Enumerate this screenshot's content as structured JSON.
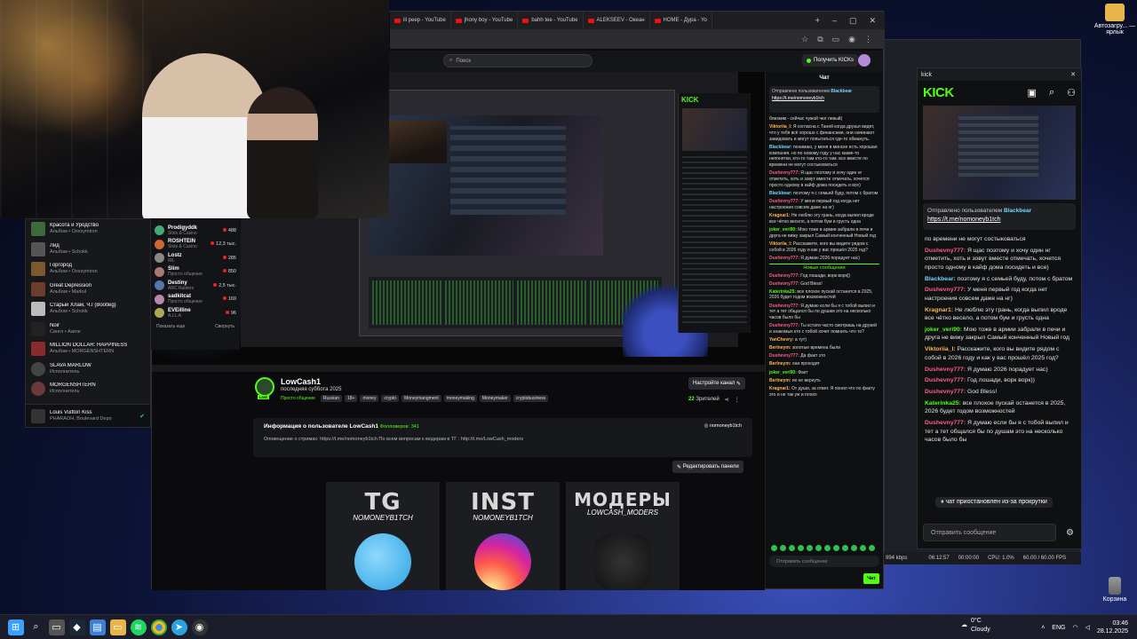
{
  "desktop": {
    "icons": [
      {
        "label": "Автозагру... — ярлык"
      },
      {
        "label": "Корзина"
      }
    ]
  },
  "browser": {
    "tabs": [
      {
        "label": "lil peep - YouTube"
      },
      {
        "label": "jhony boy - YouTube"
      },
      {
        "label": "bahh tee - YouTube"
      },
      {
        "label": "ALEKSEEV - Океан"
      },
      {
        "label": "HOME - Дура - Yo"
      }
    ],
    "search_placeholder": "Поиск",
    "get_kicks": "Получить KICKs"
  },
  "music": {
    "items": [
      {
        "title": "Красота и Уродство",
        "sub": "Альбом • Oxxxymiron",
        "color": "#3c6a3c"
      },
      {
        "title": "Лйд",
        "sub": "Альбом • Schokk",
        "color": "#555"
      },
      {
        "title": "Горгород",
        "sub": "Альбом • Oxxxymiron",
        "color": "#7a5a2a"
      },
      {
        "title": "Great Depression",
        "sub": "Альбом • Markul",
        "color": "#6b3e2a"
      },
      {
        "title": "Старый Хлам, Ч.I (Bootleg)",
        "sub": "Альбом • Schokk",
        "color": "#bbb"
      },
      {
        "title": "Noir",
        "sub": "Сингл • Aarne",
        "color": "#222"
      },
      {
        "title": "MILLION DOLLAR: HAPPINESS",
        "sub": "Альбом • MORGENSHTERN",
        "color": "#8a2a2a"
      },
      {
        "title": "SLAVA MARLOW",
        "sub": "Исполнитель",
        "color": "#444"
      },
      {
        "title": "MORGENSHTERN",
        "sub": "Исполнитель",
        "color": "#6a3a3a"
      }
    ],
    "now_playing": {
      "title": "Louis Vuitton Kiss",
      "sub": "PHARAOH, Boulevard Depo"
    }
  },
  "channels": {
    "items": [
      {
        "name": "Prodigyddk",
        "cat": "Slots & Casino",
        "viewers": "488",
        "color": "#4a7"
      },
      {
        "name": "ROSHTEIN",
        "cat": "Slots & Casino",
        "viewers": "12,3 тыс.",
        "color": "#c63"
      },
      {
        "name": "Lostz",
        "cat": "IRL",
        "viewers": "285",
        "color": "#888"
      },
      {
        "name": "Slim",
        "cat": "Просто общение",
        "viewers": "850",
        "color": "#a77"
      },
      {
        "name": "Destiny",
        "cat": "ARC Raiders",
        "viewers": "2,5 тыс.",
        "color": "#57a"
      },
      {
        "name": "sadkitcat",
        "cat": "Просто общение",
        "viewers": "169",
        "color": "#b8a"
      },
      {
        "name": "EVEilline",
        "cat": "A.I.L.A",
        "viewers": "96",
        "color": "#aa5"
      }
    ],
    "show_more": "Показать еще",
    "collapse": "Свернуть"
  },
  "channel": {
    "name": "LowCash1",
    "last_seen": "последняя суббота 2025",
    "category": "Просто общение",
    "tags": [
      "Russian",
      "18+",
      "money",
      "crypto",
      "Moneymangment",
      "moneymaking",
      "Moneymaker",
      "cryptobusiness"
    ],
    "setup_button": "Настройте канал",
    "viewers": "22",
    "viewers_label": "Зрителей",
    "about_title": "Информация о пользователе LowCash1",
    "followers_label": "Фолловеров:",
    "followers": "341",
    "about_text": "Оповещение о стримах: https://t.me/nomoneyb1tch  По всем вопросам к модерам в ТГ : http://t.me/LowCash_moders",
    "social": "nomoneyb1tch",
    "edit_panels": "Редактировать панели",
    "panels": [
      {
        "big": "TG",
        "small": "NOMONEYB1TCH",
        "logo": "telegram"
      },
      {
        "big": "INST",
        "small": "NOMONEYB1TCH",
        "logo": "instagram"
      },
      {
        "big": "МОДЕРЫ",
        "small": "LOWCASH_MODERS",
        "logo": "dog"
      }
    ]
  },
  "chat": {
    "title": "Чат",
    "pinned_label": "Отправлено пользователем",
    "pinned_user": "Blackbear",
    "pinned_link": "https://t.me/nomoneyb1tch",
    "messages": [
      {
        "user": "",
        "text": "близким - сейчас чужой чел левый)"
      },
      {
        "user": "Viktoriia_l:",
        "text": "Я согласна с Таней когда друзья видят, что у тебя всё хорошо с финансами, они начинают завидовать и могут попытаться где-то обмануть."
      },
      {
        "user": "Blackbear:",
        "text": "понимаю, у меня в минске есть хорошая компания. но по новому году у нас какие-то непонятки, кто-то там кто-то там. все вместе по времени не могут состыковаться"
      },
      {
        "user": "Dushevny777:",
        "text": "Я щас поэтому и хочу один нг отметить, хоть и зовут вместе отмечать, хочется просто одному в кайф дома посидеть и все)"
      },
      {
        "user": "Blackbear:",
        "text": "поэтому я с семьей буду, потом с братом"
      },
      {
        "user": "Dushevny777:",
        "text": "У меня первый год когда нет настроения совсем даже на нг)"
      },
      {
        "user": "Kragnar1:",
        "text": "Не люблю эту грань, когда выпил вроде все чётко весело, а потом бум и грусть одна"
      },
      {
        "user": "joker_veri90:",
        "text": "Мою тоже в армии забрали в печи и друга не вижу закрыл Самый конченный Новый год"
      },
      {
        "user": "Viktoriia_l:",
        "text": "Расскажите, кого вы видите рядом с собой в 2026 году и как у вас прошёл 2025 год?"
      },
      {
        "user": "Dushevny777:",
        "text": "Я думаю 2026 порадует нас)"
      }
    ],
    "new_messages": "Новые сообщения",
    "messages2": [
      {
        "user": "Dushevny777:",
        "text": "Год лошади, ворк ворк))"
      },
      {
        "user": "Dushevny777:",
        "text": "God Bless!"
      },
      {
        "user": "Katerinka25:",
        "text": "все плохое пускай останется в 2025, 2026 будет годом возможностей"
      },
      {
        "user": "Dushevny777:",
        "text": "Я думаю если бы я с тобой выпил и тет а тет общался бы по душам это на несколько часов было бы"
      },
      {
        "user": "Dushevny777:",
        "text": "Ты кстати часто смотришь на друзей и знакомых кто с тобой хочет помнить что то?"
      },
      {
        "user": "YanChevry:",
        "text": "а тут)"
      },
      {
        "user": "Berlneym:",
        "text": "золотые времена были"
      },
      {
        "user": "Dushevny777:",
        "text": "Да факт это"
      },
      {
        "user": "Berlneym:",
        "text": "они проходят"
      },
      {
        "user": "joker_veri90:",
        "text": "Факт"
      },
      {
        "user": "Berlneym:",
        "text": "их не вернуть"
      },
      {
        "user": "Kragnar1:",
        "text": "От души, за ответ. Я понял что по факту это и не так уж и плохо"
      }
    ],
    "input_placeholder": "Отправить сообщение",
    "send_label": "Чат"
  },
  "popout": {
    "window_title": "kick",
    "logo": "KICK",
    "pinned_label": "Отправлено пользователем",
    "pinned_user": "Blackbear",
    "pinned_link": "https://t.me/nomoneyb1tch",
    "messages": [
      {
        "user": "",
        "text": "по времени не могут состыковаться",
        "cls": ""
      },
      {
        "user": "Dushevny777:",
        "text": "Я щас поэтому и хочу один нг отметить, хоть и зовут вместе отмечать, хочется просто одному в кайф дома посидеть и все)",
        "cls": "u-p"
      },
      {
        "user": "Blackbear:",
        "text": "поэтому я с семьей буду, потом с братом",
        "cls": "u-c"
      },
      {
        "user": "Dushevny777:",
        "text": "У меня первый год когда нет настроения совсем даже на нг)",
        "cls": "u-p"
      },
      {
        "user": "Kragnar1:",
        "text": "Не люблю эту грань, когда выпил вроде все чётко весело, а потом бум и грусть одна",
        "cls": "u-o"
      },
      {
        "user": "joker_veri90:",
        "text": "Мою тоже в армии забрали в печи и друга не вижу закрыл Самый конченный Новый год",
        "cls": "u-g"
      },
      {
        "user": "Viktoriia_l:",
        "text": "Расскажите, кого вы видите рядом с собой в 2026 году и как у вас прошёл 2025 год?",
        "cls": "u-o"
      },
      {
        "user": "Dushevny777:",
        "text": "Я думаю 2026 порадует нас)",
        "cls": "u-p"
      },
      {
        "user": "Dushevny777:",
        "text": "Год лошади, ворк ворк))",
        "cls": "u-p"
      },
      {
        "user": "Dushevny777:",
        "text": "God Bless!",
        "cls": "u-p"
      },
      {
        "user": "Katerinka25:",
        "text": "все плохое пускай останется в 2025, 2026 будет годом возможностей",
        "cls": "u-g"
      },
      {
        "user": "Dushevny777:",
        "text": "Я думаю если бы я с тобой выпил и тет а тет общался бы по душам это на несколько часов было бы",
        "cls": "u-p"
      }
    ],
    "paused": "чат приостановлен из-за прокрутки",
    "input_placeholder": "Отправить сообщение"
  },
  "obs": {
    "bitrate": "994 kbps",
    "time1": "06:12:57",
    "time2": "00:00:00",
    "cpu": "CPU: 1.0%",
    "fps": "60.00 / 60.00 FPS"
  },
  "taskbar": {
    "weather_temp": "0°C",
    "weather_desc": "Cloudy",
    "lang": "ENG",
    "time": "03:46",
    "date": "28.12.2025"
  }
}
